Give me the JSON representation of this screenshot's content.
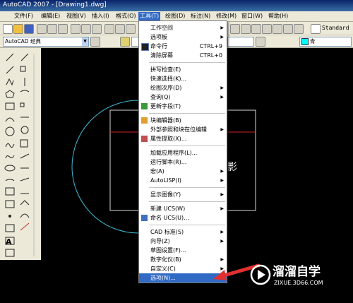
{
  "window": {
    "title": "AutoCAD 2007 - [Drawing1.dwg]"
  },
  "menubar": {
    "items": [
      {
        "id": "file",
        "label": "文件(F)"
      },
      {
        "id": "edit",
        "label": "编辑(E)"
      },
      {
        "id": "view",
        "label": "视图(V)"
      },
      {
        "id": "insert",
        "label": "插入(I)"
      },
      {
        "id": "format",
        "label": "格式(O)"
      },
      {
        "id": "tools",
        "label": "工具(T)"
      },
      {
        "id": "draw",
        "label": "绘图(D)"
      },
      {
        "id": "dimension",
        "label": "标注(N)"
      },
      {
        "id": "modify",
        "label": "修改(M)"
      },
      {
        "id": "window",
        "label": "窗口(W)"
      },
      {
        "id": "help",
        "label": "帮助(H)"
      }
    ]
  },
  "toolbar": {
    "workspace": "AutoCAD 经典",
    "text_style": "Standard",
    "color": "青"
  },
  "tools_menu": {
    "items": [
      {
        "label": "工作空间",
        "shortcut": "",
        "submenu": true
      },
      {
        "label": "选项板",
        "shortcut": "",
        "submenu": true
      },
      {
        "label": "命令行",
        "shortcut": "CTRL+9",
        "submenu": false
      },
      {
        "label": "清除屏幕",
        "shortcut": "CTRL+0",
        "submenu": false
      },
      {
        "label": "拼写检查(E)",
        "shortcut": "",
        "submenu": false
      },
      {
        "label": "快速选择(K)...",
        "shortcut": "",
        "submenu": false
      },
      {
        "label": "绘图次序(D)",
        "shortcut": "",
        "submenu": true
      },
      {
        "label": "查询(Q)",
        "shortcut": "",
        "submenu": true
      },
      {
        "label": "更新字段(T)",
        "shortcut": "",
        "submenu": false
      },
      {
        "label": "块编辑器(B)",
        "shortcut": "",
        "submenu": false
      },
      {
        "label": "外部参照和块在位编辑",
        "shortcut": "",
        "submenu": true
      },
      {
        "label": "属性提取(X)...",
        "shortcut": "",
        "submenu": false
      },
      {
        "label": "加载应用程序(L)...",
        "shortcut": "",
        "submenu": false
      },
      {
        "label": "运行脚本(R)...",
        "shortcut": "",
        "submenu": false
      },
      {
        "label": "宏(A)",
        "shortcut": "",
        "submenu": true
      },
      {
        "label": "AutoLISP(I)",
        "shortcut": "",
        "submenu": true
      },
      {
        "label": "显示图像(Y)",
        "shortcut": "",
        "submenu": true
      },
      {
        "label": "新建 UCS(W)",
        "shortcut": "",
        "submenu": true
      },
      {
        "label": "命名 UCS(U)...",
        "shortcut": "",
        "submenu": false
      },
      {
        "label": "CAD 标准(S)",
        "shortcut": "",
        "submenu": true
      },
      {
        "label": "向导(Z)",
        "shortcut": "",
        "submenu": true
      },
      {
        "label": "草图设置(F)...",
        "shortcut": "",
        "submenu": false
      },
      {
        "label": "数字化仪(B)",
        "shortcut": "",
        "submenu": true
      },
      {
        "label": "自定义(C)",
        "shortcut": "",
        "submenu": true
      },
      {
        "label": "选项(N)...",
        "shortcut": "",
        "submenu": false
      }
    ]
  },
  "canvas": {
    "text_fragment": "影"
  },
  "watermark": {
    "text": "溜溜自学",
    "url": "ZIXUE.3D66.COM"
  },
  "colors": {
    "highlight": "#316ac5",
    "titlebar": "#0a246a",
    "arrow": "#e03030"
  }
}
